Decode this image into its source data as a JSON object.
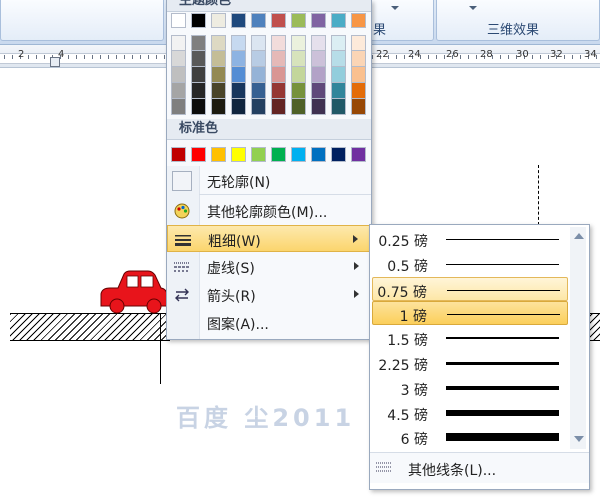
{
  "ribbon": {
    "tab_partial": "果",
    "tab_3d": "三维效果"
  },
  "ruler": {
    "labels": [
      "2",
      "4",
      "22",
      "24",
      "26",
      "28",
      "30",
      "32",
      "34"
    ]
  },
  "palette": {
    "theme_header": "主题颜色",
    "standard_header": "标准色",
    "theme_top": [
      "#ffffff",
      "#000000",
      "#eeece1",
      "#1f497d",
      "#4f81bd",
      "#c0504d",
      "#9bbb59",
      "#8064a2",
      "#4bacc6",
      "#f79646"
    ],
    "theme_shades": [
      [
        "#f2f2f2",
        "#7f7f7f",
        "#ddd9c3",
        "#c6d9f0",
        "#dbe5f1",
        "#f2dcdb",
        "#ebf1dd",
        "#e5e0ec",
        "#dbeef3",
        "#fdeada"
      ],
      [
        "#d8d8d8",
        "#595959",
        "#c4bd97",
        "#8db3e2",
        "#b8cce4",
        "#e5b9b7",
        "#d7e3bc",
        "#ccc1d9",
        "#b7dde8",
        "#fbd5b5"
      ],
      [
        "#bfbfbf",
        "#3f3f3f",
        "#938953",
        "#548dd4",
        "#95b3d7",
        "#d99694",
        "#c3d69b",
        "#b2a2c7",
        "#92cddc",
        "#fac08f"
      ],
      [
        "#a5a5a5",
        "#262626",
        "#494429",
        "#17365d",
        "#366092",
        "#953734",
        "#76923c",
        "#5f497a",
        "#31859b",
        "#e36c09"
      ],
      [
        "#7f7f7f",
        "#0c0c0c",
        "#1d1b10",
        "#0f243e",
        "#244061",
        "#632423",
        "#4f6128",
        "#3f3151",
        "#205867",
        "#974806"
      ]
    ],
    "standard": [
      "#c00000",
      "#ff0000",
      "#ffc000",
      "#ffff00",
      "#92d050",
      "#00b050",
      "#00b0f0",
      "#0070c0",
      "#002060",
      "#7030a0"
    ]
  },
  "menu": {
    "no_outline": "无轮廓(N)",
    "more_colors": "其他轮廓颜色(M)...",
    "weight": "粗细(W)",
    "dashes": "虚线(S)",
    "arrows": "箭头(R)",
    "pattern": "图案(A)..."
  },
  "weights": {
    "items": [
      {
        "label": "0.25 磅",
        "value": 0.25
      },
      {
        "label": "0.5 磅",
        "value": 0.5
      },
      {
        "label": "0.75 磅",
        "value": 0.75
      },
      {
        "label": "1 磅",
        "value": 1
      },
      {
        "label": "1.5 磅",
        "value": 1.5
      },
      {
        "label": "2.25 磅",
        "value": 2.25
      },
      {
        "label": "3 磅",
        "value": 3
      },
      {
        "label": "4.5 磅",
        "value": 4.5
      },
      {
        "label": "6 磅",
        "value": 6
      }
    ],
    "hover_index": 2,
    "selected_index": 3,
    "more_lines": "其他线条(L)..."
  },
  "document": {
    "watermark": "百度  尘2011",
    "car_color": "#e8141b"
  }
}
